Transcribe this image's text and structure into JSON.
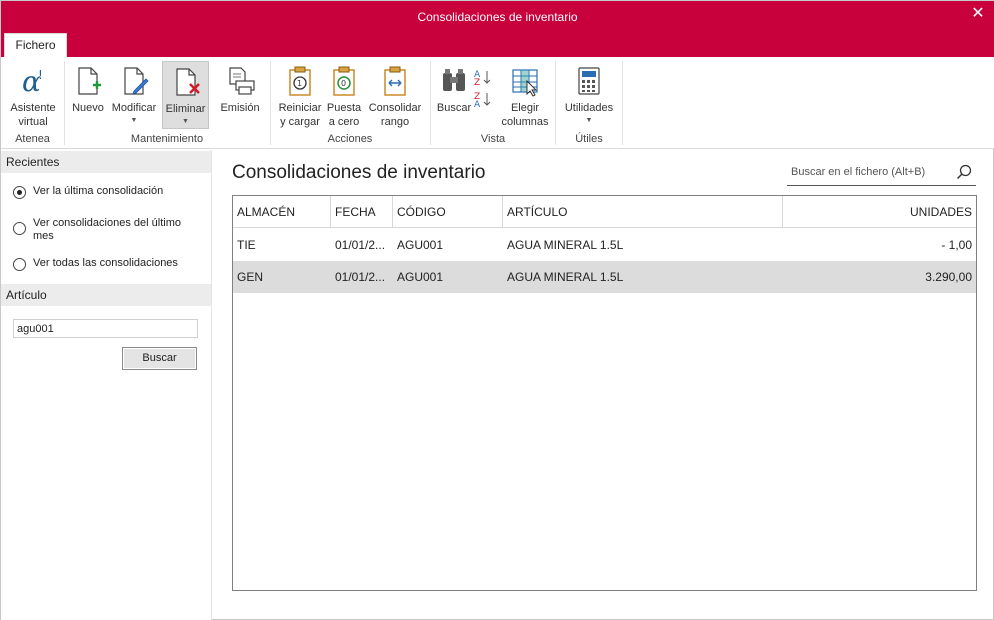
{
  "window": {
    "title": "Consolidaciones de inventario"
  },
  "tabs": [
    {
      "label": "Fichero"
    }
  ],
  "ribbon": {
    "groups": {
      "atenea": "Atenea",
      "mantenimiento": "Mantenimiento",
      "acciones": "Acciones",
      "vista": "Vista",
      "utiles": "Útiles"
    },
    "buttons": {
      "asistente": [
        "Asistente",
        "virtual"
      ],
      "nuevo": "Nuevo",
      "modificar": "Modificar",
      "eliminar": "Eliminar",
      "emision": "Emisión",
      "reiniciar": [
        "Reiniciar",
        "y cargar"
      ],
      "puesta": [
        "Puesta",
        "a cero"
      ],
      "consolidar": [
        "Consolidar",
        "rango"
      ],
      "buscar": "Buscar",
      "elegir": [
        "Elegir",
        "columnas"
      ],
      "utilidades": "Utilidades"
    }
  },
  "left_panel": {
    "recientes_header": "Recientes",
    "options": [
      {
        "label": "Ver la última consolidación",
        "checked": true
      },
      {
        "label": "Ver consolidaciones del último mes",
        "checked": false
      },
      {
        "label": "Ver todas las consolidaciones",
        "checked": false
      }
    ],
    "articulo_header": "Artículo",
    "articulo_value": "agu001",
    "buscar_button": "Buscar"
  },
  "main": {
    "title": "Consolidaciones de inventario",
    "search_placeholder": "Buscar en el fichero (Alt+B)",
    "columns": [
      "ALMACÉN",
      "FECHA",
      "CÓDIGO",
      "ARTÍCULO",
      "UNIDADES"
    ],
    "rows": [
      {
        "almacen": "TIE",
        "fecha": "01/01/2...",
        "codigo": "AGU001",
        "articulo": "AGUA MINERAL 1.5L",
        "unidades": "- 1,00",
        "selected": false
      },
      {
        "almacen": "GEN",
        "fecha": "01/01/2...",
        "codigo": "AGU001",
        "articulo": "AGUA MINERAL 1.5L",
        "unidades": "3.290,00",
        "selected": true
      }
    ]
  },
  "colors": {
    "accent": "#c8003b",
    "selected_row": "#dcdcdc"
  }
}
